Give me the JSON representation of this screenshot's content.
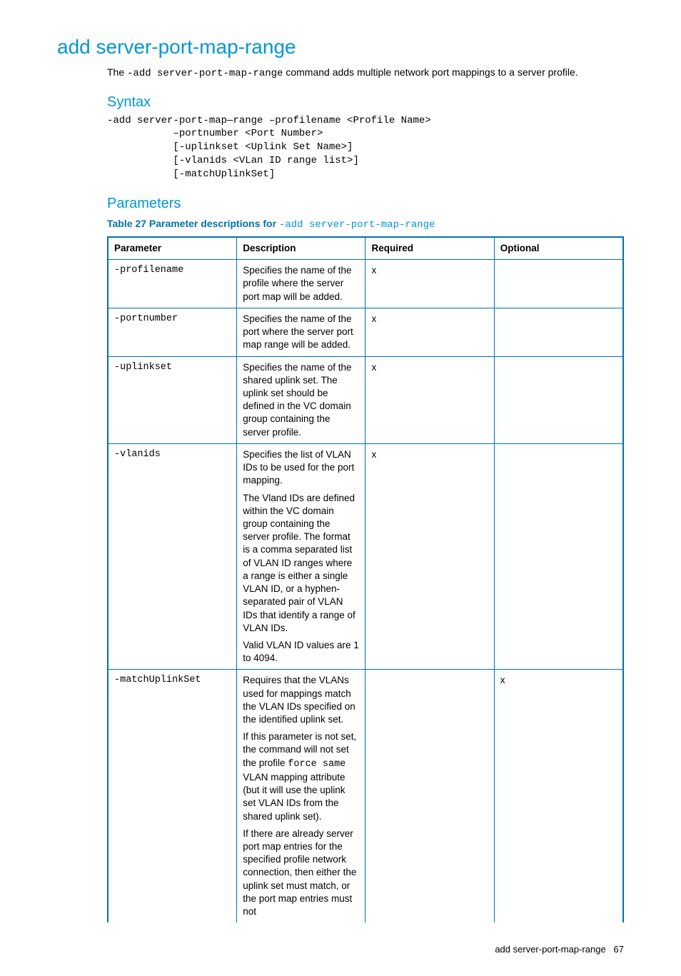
{
  "page_title": "add server-port-map-range",
  "intro_pre": "The ",
  "intro_code": "-add server-port-map-range",
  "intro_post": " command adds multiple network port mappings to a server profile.",
  "syntax_heading": "Syntax",
  "syntax_block": "-add server-port-map—range –profilename <Profile Name>\n           –portnumber <Port Number>\n           [-uplinkset <Uplink Set Name>]\n           [-vlanids <VLan ID range list>]\n           [-matchUplinkSet]",
  "params_heading": "Parameters",
  "table_caption_label": "Table 27 Parameter descriptions for ",
  "table_caption_code": "-add server-port-map-range",
  "headers": {
    "param": "Parameter",
    "desc": "Description",
    "req": "Required",
    "opt": "Optional"
  },
  "rows": [
    {
      "param": "-profilename",
      "desc": [
        "Specifies the name of the profile where the server port map will be added."
      ],
      "req": "x",
      "opt": ""
    },
    {
      "param": "-portnumber",
      "desc": [
        "Specifies the name of the port where the server port map range will be added."
      ],
      "req": "x",
      "opt": ""
    },
    {
      "param": "-uplinkset",
      "desc": [
        "Specifies the name of the shared uplink set. The uplink set should be defined in the VC domain group containing the server profile."
      ],
      "req": "x",
      "opt": ""
    },
    {
      "param": "-vlanids",
      "desc": [
        "Specifies the list of VLAN IDs to be used for the port mapping.",
        "The Vland IDs are defined within the VC domain group containing the server profile. The format is a comma separated list of VLAN ID ranges where a range is either a single VLAN ID, or a hyphen-separated pair of VLAN IDs that identify a range of VLAN IDs.",
        "Valid VLAN ID values are 1 to 4094."
      ],
      "req": "x",
      "opt": ""
    },
    {
      "param": "-matchUplinkSet",
      "desc_special": {
        "p1": "Requires that the VLANs used for mappings match the VLAN IDs specified on the identified uplink set.",
        "p2_pre": "If this parameter is not set, the command will not set the profile ",
        "p2_code": "force same",
        "p2_post": " VLAN mapping attribute (but it will use the uplink set VLAN IDs from the shared uplink set).",
        "p3": "If there are already server port map entries for the specified profile network connection, then either the uplink set must match, or the port map entries must not"
      },
      "req": "",
      "opt": "x"
    }
  ],
  "footer_text": "add server-port-map-range",
  "footer_page": "67"
}
